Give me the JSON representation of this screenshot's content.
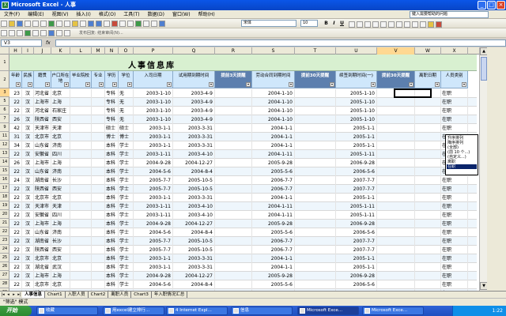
{
  "window": {
    "title": "Microsoft Excel - 人事",
    "min": "_",
    "max": "□",
    "close": "×"
  },
  "menubar": [
    "文件(F)",
    "编辑(E)",
    "视图(V)",
    "插入(I)",
    "格式(O)",
    "工具(T)",
    "数据(D)",
    "窗口(W)",
    "帮助(H)"
  ],
  "help_placeholder": "键入需要帮助的问题",
  "toolbar": {
    "font": "宋体",
    "size": "10",
    "bold": "B",
    "italic": "I",
    "underline": "U",
    "toolbar2_text": "发布回复: 结束审阅(N)..."
  },
  "formula_bar": {
    "name_box": "V3",
    "fx": "fx",
    "value": ""
  },
  "columns": [
    "H",
    "I",
    "J",
    "K",
    "L",
    "M",
    "N",
    "O",
    "P",
    "Q",
    "R",
    "S",
    "T",
    "U",
    "V",
    "W",
    "X"
  ],
  "selected_column": "V",
  "row_numbers": [
    "1",
    "2",
    "3",
    "5",
    "6",
    "7",
    "9",
    "11",
    "12",
    "13",
    "14",
    "15",
    "16",
    "17",
    "18",
    "19",
    "20",
    "21",
    "22",
    "23",
    "24",
    "25",
    "26",
    "27",
    "28",
    "29",
    "30"
  ],
  "selected_row": "3",
  "sheet_title": "人事信息库",
  "headers": [
    "年龄",
    "民族",
    "籍贯",
    "户口所在地",
    "毕业院校",
    "专业",
    "学历",
    "学位",
    "入司日期",
    "试用期到期时间",
    "提前3天提醒",
    "劳动合同到期时间",
    "提前30天提醒",
    "续签到期时间(一)",
    "提前30天提醒",
    "离职日期",
    "人员类别"
  ],
  "rows": [
    [
      "23",
      "汉",
      "河北省",
      "北京",
      "",
      "",
      "专科",
      "无",
      "2003-1-10",
      "2003-4-9",
      "",
      "2004-1-10",
      "",
      "2005-1-10",
      "",
      "",
      "在职"
    ],
    [
      "22",
      "汉",
      "上海市",
      "上海",
      "",
      "",
      "专科",
      "无",
      "2003-1-10",
      "2003-4-9",
      "",
      "2004-1-10",
      "",
      "2005-1-10",
      "",
      "",
      "在职"
    ],
    [
      "22",
      "汉",
      "河北省",
      "石家庄",
      "",
      "",
      "专科",
      "无",
      "2003-1-10",
      "2003-4-9",
      "",
      "2004-1-10",
      "",
      "2005-1-10",
      "",
      "",
      "在职"
    ],
    [
      "26",
      "汉",
      "陕西省",
      "西安",
      "",
      "",
      "专科",
      "无",
      "2003-1-10",
      "2003-4-9",
      "",
      "2004-1-10",
      "",
      "2005-1-10",
      "",
      "",
      "在职"
    ],
    [
      "42",
      "汉",
      "天津市",
      "天津",
      "",
      "",
      "硕士",
      "硕士",
      "2003-1-1",
      "2003-3-31",
      "",
      "2004-1-1",
      "",
      "2005-1-1",
      "",
      "",
      "在职"
    ],
    [
      "31",
      "汉",
      "北京市",
      "北京",
      "",
      "",
      "博士",
      "博士",
      "2003-1-1",
      "2003-3-31",
      "",
      "2004-1-1",
      "",
      "2005-1-1",
      "",
      "",
      "在职"
    ],
    [
      "34",
      "汉",
      "山东省",
      "济南",
      "",
      "",
      "本科",
      "学士",
      "2003-1-1",
      "2003-3-31",
      "",
      "2004-1-1",
      "",
      "2005-1-1",
      "",
      "",
      "在职"
    ],
    [
      "22",
      "汉",
      "安徽省",
      "四川",
      "",
      "",
      "本科",
      "学士",
      "2003-1-11",
      "2003-4-10",
      "",
      "2004-1-11",
      "",
      "2005-1-11",
      "",
      "",
      "在职"
    ],
    [
      "26",
      "汉",
      "上海市",
      "上海",
      "",
      "",
      "本科",
      "学士",
      "2004-9-28",
      "2004-12-27",
      "",
      "2005-9-28",
      "",
      "2006-9-28",
      "",
      "",
      "在职"
    ],
    [
      "22",
      "汉",
      "山东省",
      "济南",
      "",
      "",
      "本科",
      "学士",
      "2004-5-6",
      "2004-8-4",
      "",
      "2005-5-6",
      "",
      "2006-5-6",
      "",
      "",
      "在职"
    ],
    [
      "24",
      "汉",
      "湖南省",
      "长沙",
      "",
      "",
      "本科",
      "学士",
      "2005-7-7",
      "2005-10-5",
      "",
      "2006-7-7",
      "",
      "2007-7-7",
      "",
      "",
      "在职"
    ],
    [
      "22",
      "汉",
      "陕西省",
      "西安",
      "",
      "",
      "本科",
      "学士",
      "2005-7-7",
      "2005-10-5",
      "",
      "2006-7-7",
      "",
      "2007-7-7",
      "",
      "",
      "在职"
    ],
    [
      "22",
      "汉",
      "北京市",
      "北京",
      "",
      "",
      "本科",
      "学士",
      "2003-1-1",
      "2003-3-31",
      "",
      "2004-1-1",
      "",
      "2005-1-1",
      "",
      "",
      "在职"
    ],
    [
      "22",
      "汉",
      "天津市",
      "天津",
      "",
      "",
      "本科",
      "学士",
      "2003-1-11",
      "2003-4-10",
      "",
      "2004-1-11",
      "",
      "2005-1-11",
      "",
      "",
      "在职"
    ],
    [
      "22",
      "汉",
      "安徽省",
      "四川",
      "",
      "",
      "本科",
      "学士",
      "2003-1-11",
      "2003-4-10",
      "",
      "2004-1-11",
      "",
      "2005-1-11",
      "",
      "",
      "在职"
    ],
    [
      "22",
      "汉",
      "上海市",
      "上海",
      "",
      "",
      "本科",
      "学士",
      "2004-9-28",
      "2004-12-27",
      "",
      "2005-9-28",
      "",
      "2006-9-28",
      "",
      "",
      "在职"
    ],
    [
      "22",
      "汉",
      "山东省",
      "济南",
      "",
      "",
      "本科",
      "学士",
      "2004-5-6",
      "2004-8-4",
      "",
      "2005-5-6",
      "",
      "2006-5-6",
      "",
      "",
      "在职"
    ],
    [
      "22",
      "汉",
      "湖南省",
      "长沙",
      "",
      "",
      "本科",
      "学士",
      "2005-7-7",
      "2005-10-5",
      "",
      "2006-7-7",
      "",
      "2007-7-7",
      "",
      "",
      "在职"
    ],
    [
      "22",
      "汉",
      "陕西省",
      "西安",
      "",
      "",
      "本科",
      "学士",
      "2005-7-7",
      "2005-10-5",
      "",
      "2006-7-7",
      "",
      "2007-7-7",
      "",
      "",
      "在职"
    ],
    [
      "22",
      "汉",
      "北京市",
      "北京",
      "",
      "",
      "本科",
      "学士",
      "2003-1-1",
      "2003-3-31",
      "",
      "2004-1-1",
      "",
      "2005-1-1",
      "",
      "",
      "在职"
    ],
    [
      "22",
      "汉",
      "湖北省",
      "武汉",
      "",
      "",
      "本科",
      "学士",
      "2003-1-1",
      "2003-3-31",
      "",
      "2004-1-1",
      "",
      "2005-1-1",
      "",
      "",
      "在职"
    ],
    [
      "22",
      "汉",
      "上海市",
      "上海",
      "",
      "",
      "本科",
      "学士",
      "2004-9-28",
      "2004-12-27",
      "",
      "2005-9-28",
      "",
      "2006-9-28",
      "",
      "",
      "在职"
    ],
    [
      "22",
      "汉",
      "北京市",
      "北京",
      "",
      "",
      "本科",
      "学士",
      "2004-5-6",
      "2004-8-4",
      "",
      "2005-5-6",
      "",
      "2006-5-6",
      "",
      "",
      "在职"
    ],
    [
      "22",
      "汉",
      "湖南省",
      "长沙",
      "",
      "",
      "本科",
      "学士",
      "2005-7-7",
      "2005-10-5",
      "",
      "2006-7-7",
      "",
      "2007-7-7",
      "",
      "",
      "在职"
    ],
    [
      "22",
      "汉",
      "陕西省",
      "西安",
      "",
      "",
      "本科",
      "学士",
      "2005-7-7",
      "2005-10-5",
      "",
      "2006-7-7",
      "",
      "2007-7-7",
      "",
      "",
      "在职"
    ]
  ],
  "autofilter_popup": [
    "升序排列",
    "降序排列",
    "(全部)",
    "(前 10 个...)",
    "(自定义...)",
    "离职",
    "在职"
  ],
  "autofilter_selected": "在职",
  "sheet_tabs": [
    "人事信息",
    "Chart1",
    "入职人员",
    "Chart2",
    "离职人员",
    "Chart3",
    "年入职情况汇总"
  ],
  "active_tab": "人事信息",
  "status": "\"筛选\" 模式",
  "taskbar": {
    "start": "开始",
    "tasks": [
      "收藏",
      "用excel建立排行...",
      "4 Internet Expl...",
      "信息",
      "Microsoft Exce...",
      "Microsoft Exce..."
    ],
    "active_task": 4,
    "clock": "1:22"
  },
  "colors": {
    "header_light": "#cfe7fb",
    "header_dark": "#5c7fae",
    "title_band": "#d8f0d0",
    "row_alt": "#eef6fc"
  }
}
